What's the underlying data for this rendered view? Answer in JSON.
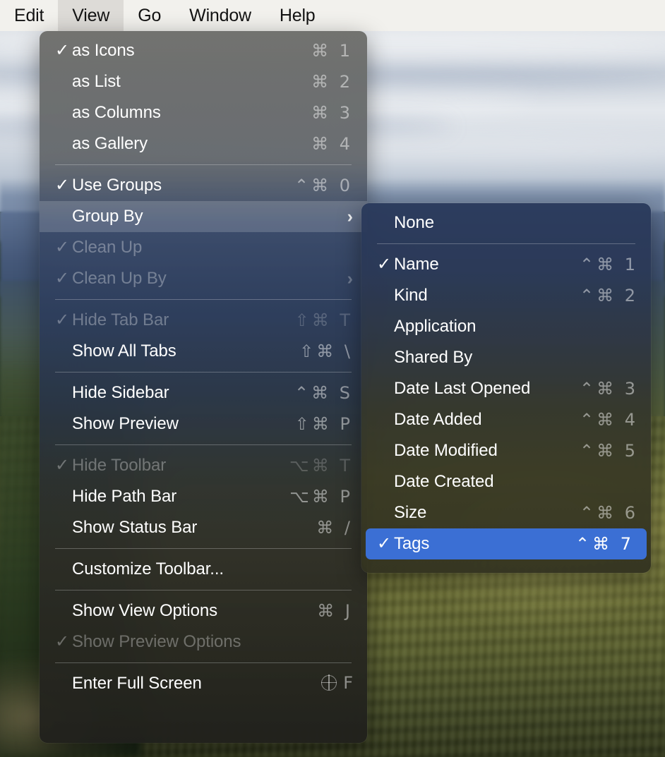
{
  "menubar": {
    "items": [
      {
        "label": "Edit",
        "active": false
      },
      {
        "label": "View",
        "active": true
      },
      {
        "label": "Go",
        "active": false
      },
      {
        "label": "Window",
        "active": false
      },
      {
        "label": "Help",
        "active": false
      }
    ]
  },
  "colors": {
    "accent_blue": "#3b6fd4",
    "menubar_bg": "#f2f1ed",
    "menubar_active_bg": "#dddbd7",
    "menu_text": "#ffffff",
    "menu_text_disabled": "rgba(255,255,255,0.32)",
    "shortcut_text": "rgba(255,255,255,0.48)"
  },
  "view_menu": {
    "name": "View",
    "items": [
      {
        "label": "as Icons",
        "shortcut": "⌘ 1",
        "checked": true,
        "disabled": false,
        "submenu": false,
        "highlight": "none"
      },
      {
        "label": "as List",
        "shortcut": "⌘ 2",
        "checked": false,
        "disabled": false,
        "submenu": false,
        "highlight": "none"
      },
      {
        "label": "as Columns",
        "shortcut": "⌘ 3",
        "checked": false,
        "disabled": false,
        "submenu": false,
        "highlight": "none"
      },
      {
        "label": "as Gallery",
        "shortcut": "⌘ 4",
        "checked": false,
        "disabled": false,
        "submenu": false,
        "highlight": "none"
      },
      {
        "separator": true
      },
      {
        "label": "Use Groups",
        "shortcut": "⌃⌘ 0",
        "checked": true,
        "disabled": false,
        "submenu": false,
        "highlight": "none"
      },
      {
        "label": "Group By",
        "shortcut": "",
        "checked": false,
        "disabled": false,
        "submenu": true,
        "highlight": "soft"
      },
      {
        "label": "Clean Up",
        "shortcut": "",
        "checked": false,
        "disabled": true,
        "submenu": false,
        "highlight": "none"
      },
      {
        "label": "Clean Up By",
        "shortcut": "",
        "checked": false,
        "disabled": true,
        "submenu": true,
        "highlight": "none"
      },
      {
        "separator": true
      },
      {
        "label": "Hide Tab Bar",
        "shortcut": "⇧⌘ T",
        "checked": false,
        "disabled": true,
        "submenu": false,
        "highlight": "none"
      },
      {
        "label": "Show All Tabs",
        "shortcut": "⇧⌘ \\",
        "checked": false,
        "disabled": false,
        "submenu": false,
        "highlight": "none"
      },
      {
        "separator": true
      },
      {
        "label": "Hide Sidebar",
        "shortcut": "⌃⌘ S",
        "checked": false,
        "disabled": false,
        "submenu": false,
        "highlight": "none"
      },
      {
        "label": "Show Preview",
        "shortcut": "⇧⌘ P",
        "checked": false,
        "disabled": false,
        "submenu": false,
        "highlight": "none"
      },
      {
        "separator": true
      },
      {
        "label": "Hide Toolbar",
        "shortcut": "⌥⌘ T",
        "checked": false,
        "disabled": true,
        "submenu": false,
        "highlight": "none"
      },
      {
        "label": "Hide Path Bar",
        "shortcut": "⌥⌘ P",
        "checked": false,
        "disabled": false,
        "submenu": false,
        "highlight": "none"
      },
      {
        "label": "Show Status Bar",
        "shortcut": "⌘ /",
        "checked": false,
        "disabled": false,
        "submenu": false,
        "highlight": "none"
      },
      {
        "separator": true
      },
      {
        "label": "Customize Toolbar...",
        "shortcut": "",
        "checked": false,
        "disabled": false,
        "submenu": false,
        "highlight": "none"
      },
      {
        "separator": true
      },
      {
        "label": "Show View Options",
        "shortcut": "⌘ J",
        "checked": false,
        "disabled": false,
        "submenu": false,
        "highlight": "none"
      },
      {
        "label": "Show Preview Options",
        "shortcut": "",
        "checked": false,
        "disabled": true,
        "submenu": false,
        "highlight": "none"
      },
      {
        "separator": true
      },
      {
        "label": "Enter Full Screen",
        "shortcut": "F",
        "checked": false,
        "disabled": false,
        "submenu": false,
        "highlight": "none",
        "icon": "globe-icon"
      }
    ]
  },
  "groupby_menu": {
    "name": "Group By",
    "items": [
      {
        "label": "None",
        "shortcut": "",
        "checked": false,
        "disabled": false,
        "highlight": "none"
      },
      {
        "separator": true
      },
      {
        "label": "Name",
        "shortcut": "⌃⌘ 1",
        "checked": true,
        "disabled": false,
        "highlight": "none"
      },
      {
        "label": "Kind",
        "shortcut": "⌃⌘ 2",
        "checked": false,
        "disabled": false,
        "highlight": "none"
      },
      {
        "label": "Application",
        "shortcut": "",
        "checked": false,
        "disabled": false,
        "highlight": "none"
      },
      {
        "label": "Shared By",
        "shortcut": "",
        "checked": false,
        "disabled": false,
        "highlight": "none"
      },
      {
        "label": "Date Last Opened",
        "shortcut": "⌃⌘ 3",
        "checked": false,
        "disabled": false,
        "highlight": "none"
      },
      {
        "label": "Date Added",
        "shortcut": "⌃⌘ 4",
        "checked": false,
        "disabled": false,
        "highlight": "none"
      },
      {
        "label": "Date Modified",
        "shortcut": "⌃⌘ 5",
        "checked": false,
        "disabled": false,
        "highlight": "none"
      },
      {
        "label": "Date Created",
        "shortcut": "",
        "checked": false,
        "disabled": false,
        "highlight": "none"
      },
      {
        "label": "Size",
        "shortcut": "⌃⌘ 6",
        "checked": false,
        "disabled": false,
        "highlight": "none"
      },
      {
        "label": "Tags",
        "shortcut": "⌃⌘ 7",
        "checked": false,
        "disabled": false,
        "highlight": "blue"
      }
    ]
  },
  "icons": {
    "checkmark": "✓",
    "chevron_right": "›",
    "globe": "globe-icon"
  }
}
